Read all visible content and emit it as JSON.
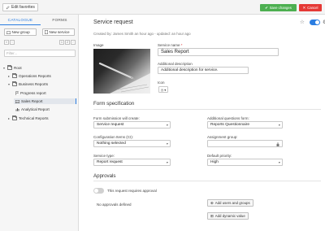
{
  "topbar": {
    "edit_favorites": "Edit favorites",
    "save_changes": "Save changes",
    "cancel": "Cancel"
  },
  "sidebar": {
    "tabs": [
      "CATALOGUE",
      "FORMS"
    ],
    "new_group": "New group",
    "new_service": "New service",
    "pager_left": [
      "‹‹",
      "‹"
    ],
    "pager_right": [
      "1",
      "2",
      "›"
    ],
    "filter_placeholder": "Filter...",
    "tree": [
      {
        "label": "Root"
      },
      {
        "label": "Operations Reports"
      },
      {
        "label": "Business Reports"
      },
      {
        "label": "Progress report"
      },
      {
        "label": "Sales Report"
      },
      {
        "label": "Analytical Report"
      },
      {
        "label": "Technical Reports"
      }
    ]
  },
  "main": {
    "title": "Service request",
    "meta": "Created by: James Smith an hour ago - updated: an hour ago",
    "image_label": "Image",
    "service_name_label": "Service name",
    "required_mark": "*",
    "service_name_value": "Sales Report",
    "additional_desc_label": "Additional description",
    "additional_desc_value": "Additional description for service.",
    "icon_label": "Icon",
    "form_spec_title": "Form specification",
    "form_submission_label": "Form submission will create:",
    "form_submission_value": "Service request",
    "additional_questions_label": "Additional questions form:",
    "additional_questions_value": "Reports Questionnaire",
    "config_items_label": "Configuration Items (CI):",
    "config_items_value": "Nothing selected",
    "assignment_group_label": "Assignment group:",
    "assignment_group_value": "",
    "service_type_label": "Service type:",
    "service_type_value": "Report request",
    "default_priority_label": "Default priority:",
    "default_priority_value": "High",
    "approvals_title": "Approvals",
    "requires_approval_label": "This request requires approval",
    "no_approvals": "No approvals defined",
    "add_users_groups": "Add users and groups",
    "add_dynamic_value": "Add dynamic value"
  },
  "colors": {
    "accent": "#2a7de1",
    "save": "#4caf50",
    "cancel": "#e53935"
  }
}
